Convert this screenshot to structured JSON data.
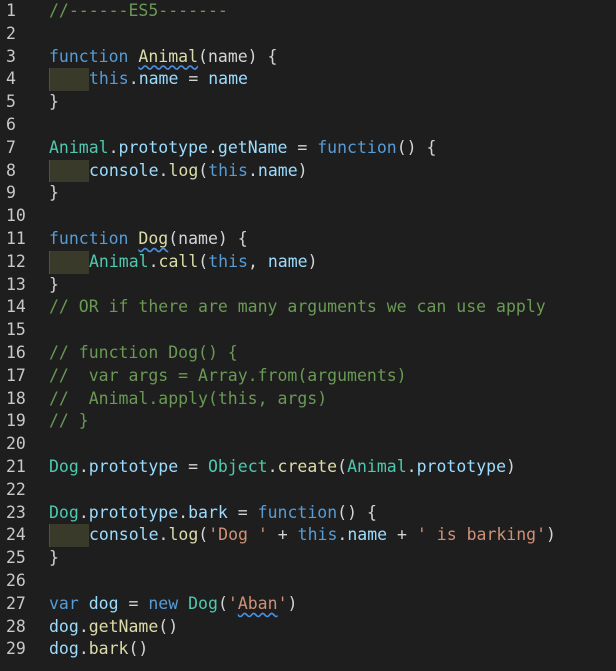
{
  "editor": {
    "lines": [
      {
        "num": "1",
        "tokens": [
          [
            "c",
            "//------ES5-------"
          ]
        ]
      },
      {
        "num": "2",
        "tokens": []
      },
      {
        "num": "3",
        "tokens": [
          [
            "k",
            "function "
          ],
          [
            "fn",
            "Animal",
            "squig"
          ],
          [
            "t",
            "(name) {"
          ]
        ]
      },
      {
        "num": "4",
        "indent": true,
        "tokens": [
          [
            "k",
            "this"
          ],
          [
            "t",
            "."
          ],
          [
            "p",
            "name"
          ],
          [
            "o",
            " = "
          ],
          [
            "p",
            "name"
          ]
        ]
      },
      {
        "num": "5",
        "tokens": [
          [
            "t",
            "}"
          ]
        ]
      },
      {
        "num": "6",
        "tokens": []
      },
      {
        "num": "7",
        "tokens": [
          [
            "cls",
            "Animal"
          ],
          [
            "t",
            "."
          ],
          [
            "p",
            "prototype"
          ],
          [
            "t",
            "."
          ],
          [
            "p",
            "getName"
          ],
          [
            "o",
            " = "
          ],
          [
            "k",
            "function"
          ],
          [
            "t",
            "() {"
          ]
        ]
      },
      {
        "num": "8",
        "indent": true,
        "tokens": [
          [
            "p",
            "console"
          ],
          [
            "t",
            "."
          ],
          [
            "fn",
            "log"
          ],
          [
            "t",
            "("
          ],
          [
            "k",
            "this"
          ],
          [
            "t",
            "."
          ],
          [
            "p",
            "name"
          ],
          [
            "t",
            ")"
          ]
        ]
      },
      {
        "num": "9",
        "tokens": [
          [
            "t",
            "}"
          ]
        ]
      },
      {
        "num": "10",
        "tokens": []
      },
      {
        "num": "11",
        "tokens": [
          [
            "k",
            "function "
          ],
          [
            "fn",
            "Dog",
            "squig"
          ],
          [
            "t",
            "(name) {"
          ]
        ]
      },
      {
        "num": "12",
        "indent": true,
        "tokens": [
          [
            "cls",
            "Animal"
          ],
          [
            "t",
            "."
          ],
          [
            "fn",
            "call"
          ],
          [
            "t",
            "("
          ],
          [
            "k",
            "this"
          ],
          [
            "t",
            ", "
          ],
          [
            "p",
            "name"
          ],
          [
            "t",
            ")"
          ]
        ]
      },
      {
        "num": "13",
        "tokens": [
          [
            "t",
            "}"
          ]
        ]
      },
      {
        "num": "14",
        "tokens": [
          [
            "c",
            "// OR if there are many arguments we can use apply"
          ]
        ]
      },
      {
        "num": "15",
        "tokens": []
      },
      {
        "num": "16",
        "tokens": [
          [
            "c",
            "// function Dog() {"
          ]
        ]
      },
      {
        "num": "17",
        "tokens": [
          [
            "c",
            "//  var args = Array.from(arguments)"
          ]
        ]
      },
      {
        "num": "18",
        "tokens": [
          [
            "c",
            "//  Animal.apply(this, args)"
          ]
        ]
      },
      {
        "num": "19",
        "tokens": [
          [
            "c",
            "// }"
          ]
        ]
      },
      {
        "num": "20",
        "tokens": []
      },
      {
        "num": "21",
        "tokens": [
          [
            "cls",
            "Dog"
          ],
          [
            "t",
            "."
          ],
          [
            "p",
            "prototype"
          ],
          [
            "o",
            " = "
          ],
          [
            "cls",
            "Object"
          ],
          [
            "t",
            "."
          ],
          [
            "fn",
            "create"
          ],
          [
            "t",
            "("
          ],
          [
            "cls",
            "Animal"
          ],
          [
            "t",
            "."
          ],
          [
            "p",
            "prototype"
          ],
          [
            "t",
            ")"
          ]
        ]
      },
      {
        "num": "22",
        "tokens": []
      },
      {
        "num": "23",
        "tokens": [
          [
            "cls",
            "Dog"
          ],
          [
            "t",
            "."
          ],
          [
            "p",
            "prototype"
          ],
          [
            "t",
            "."
          ],
          [
            "p",
            "bark"
          ],
          [
            "o",
            " = "
          ],
          [
            "k",
            "function"
          ],
          [
            "t",
            "() {"
          ]
        ]
      },
      {
        "num": "24",
        "indent": true,
        "tokens": [
          [
            "p",
            "console"
          ],
          [
            "t",
            "."
          ],
          [
            "fn",
            "log"
          ],
          [
            "t",
            "("
          ],
          [
            "s",
            "'Dog '"
          ],
          [
            "o",
            " + "
          ],
          [
            "k",
            "this"
          ],
          [
            "t",
            "."
          ],
          [
            "p",
            "name"
          ],
          [
            "o",
            " + "
          ],
          [
            "s",
            "' is barking'"
          ],
          [
            "t",
            ")"
          ]
        ]
      },
      {
        "num": "25",
        "tokens": [
          [
            "t",
            "}"
          ]
        ]
      },
      {
        "num": "26",
        "tokens": []
      },
      {
        "num": "27",
        "tokens": [
          [
            "k",
            "var "
          ],
          [
            "p",
            "dog"
          ],
          [
            "o",
            " = "
          ],
          [
            "k",
            "new "
          ],
          [
            "cls",
            "Dog"
          ],
          [
            "t",
            "("
          ],
          [
            "s",
            "'"
          ],
          [
            "s",
            "Aban",
            "squig"
          ],
          [
            "s",
            "'"
          ],
          [
            "t",
            ")"
          ]
        ]
      },
      {
        "num": "28",
        "tokens": [
          [
            "p",
            "dog"
          ],
          [
            "t",
            "."
          ],
          [
            "fn",
            "getName"
          ],
          [
            "t",
            "()"
          ]
        ]
      },
      {
        "num": "29",
        "tokens": [
          [
            "p",
            "dog"
          ],
          [
            "t",
            "."
          ],
          [
            "fn",
            "bark"
          ],
          [
            "t",
            "()"
          ]
        ]
      }
    ]
  }
}
